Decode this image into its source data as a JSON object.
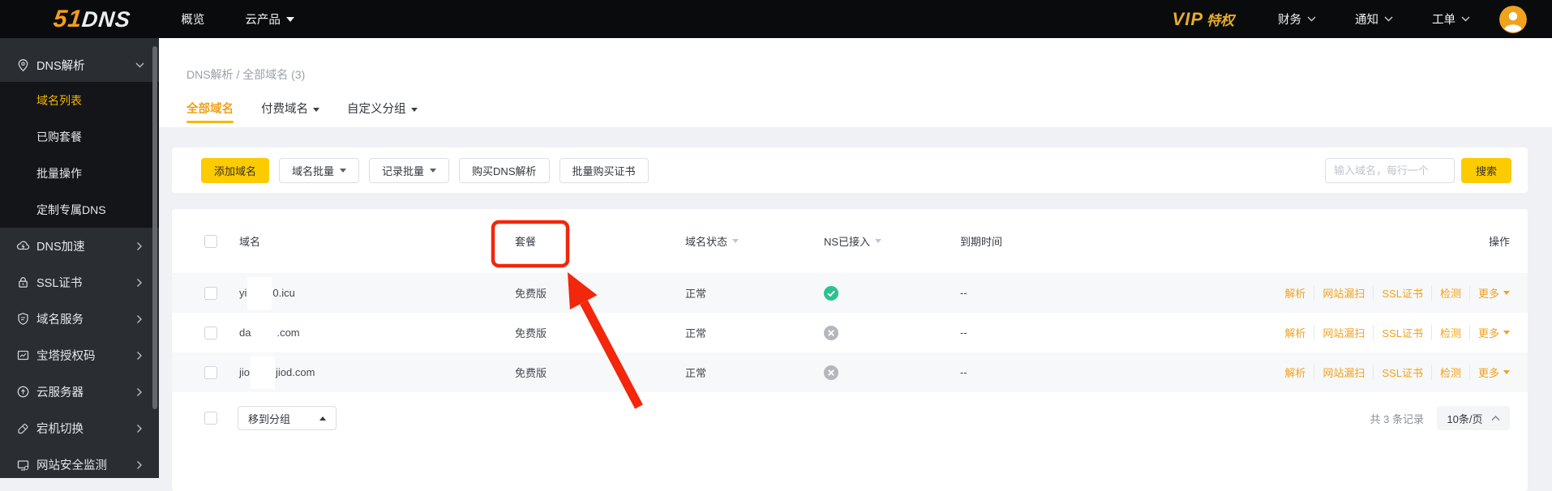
{
  "topbar": {
    "logo": {
      "part1": "51",
      "part2": "DNS"
    },
    "nav": [
      {
        "label": "概览"
      },
      {
        "label": "云产品"
      }
    ],
    "vip": {
      "part1": "VIP",
      "part2": "特权"
    },
    "right_nav": [
      {
        "label": "财务"
      },
      {
        "label": "通知"
      },
      {
        "label": "工单"
      }
    ],
    "avatar_icon": "user-avatar-icon"
  },
  "sidebar": {
    "group_header": {
      "label": "DNS解析",
      "icon": "location-pin-icon",
      "state": "expanded"
    },
    "submenu": [
      {
        "label": "域名列表",
        "active": "true"
      },
      {
        "label": "已购套餐"
      },
      {
        "label": "批量操作"
      },
      {
        "label": "定制专属DNS"
      }
    ],
    "collapsed_items": [
      {
        "label": "DNS加速",
        "icon": "cloud-bolt-icon"
      },
      {
        "label": "SSL证书",
        "icon": "padlock-icon"
      },
      {
        "label": "域名服务",
        "icon": "shield-icon"
      },
      {
        "label": "宝塔授权码",
        "icon": "chart-frame-icon"
      },
      {
        "label": "云服务器",
        "icon": "cloud-server-icon"
      },
      {
        "label": "宕机切换",
        "icon": "switch-icon"
      },
      {
        "label": "网站安全监测",
        "icon": "monitor-icon"
      }
    ]
  },
  "breadcrumb": "DNS解析 / 全部域名 (3)",
  "tabs": [
    {
      "label": "全部域名",
      "active": "true"
    },
    {
      "label": "付费域名",
      "caret": "true"
    },
    {
      "label": "自定义分组",
      "caret": "true"
    }
  ],
  "toolbar": {
    "add_button": "添加域名",
    "buttons": [
      {
        "label": "域名批量",
        "caret": "true"
      },
      {
        "label": "记录批量",
        "caret": "true"
      },
      {
        "label": "购买DNS解析"
      },
      {
        "label": "批量购买证书"
      }
    ],
    "search_placeholder": "输入域名，每行一个",
    "search_button": "搜索"
  },
  "table": {
    "headers": {
      "domain": "域名",
      "plan": "套餐",
      "status": "域名状态",
      "ns": "NS已接入",
      "expiry": "到期时间",
      "actions": "操作"
    },
    "rows": [
      {
        "domain_prefix": "yi",
        "domain_suffix": "0.icu",
        "plan": "免费版",
        "status": "正常",
        "ns_connected": "yes",
        "expiry": "--"
      },
      {
        "domain_prefix": "da",
        "domain_suffix": ".com",
        "plan": "免费版",
        "status": "正常",
        "ns_connected": "no",
        "expiry": "--"
      },
      {
        "domain_prefix": "jio",
        "domain_suffix": "jiod.com",
        "plan": "免费版",
        "status": "正常",
        "ns_connected": "no",
        "expiry": "--"
      }
    ],
    "row_actions": [
      "解析",
      "网站漏扫",
      "SSL证书",
      "检测",
      "更多"
    ]
  },
  "footer": {
    "move_to_group": "移到分组",
    "total": "共 3 条记录",
    "page_size": "10条/页"
  },
  "annotation": {
    "type": "red-box-and-arrow",
    "target": "套餐",
    "color": "#f2270c"
  },
  "colors": {
    "accent_yellow": "#fccb00",
    "active_tab_gold": "#f0a11c",
    "link_orange": "#f0a11c",
    "ns_connected_green": "#2cc191",
    "ns_disconnected_gray": "#b4b7bb",
    "topbar_black": "#0a0b0d",
    "sidebar_dark": "#2a2d31",
    "submenu_darker": "#131519",
    "annotation_red": "#f2270c"
  }
}
